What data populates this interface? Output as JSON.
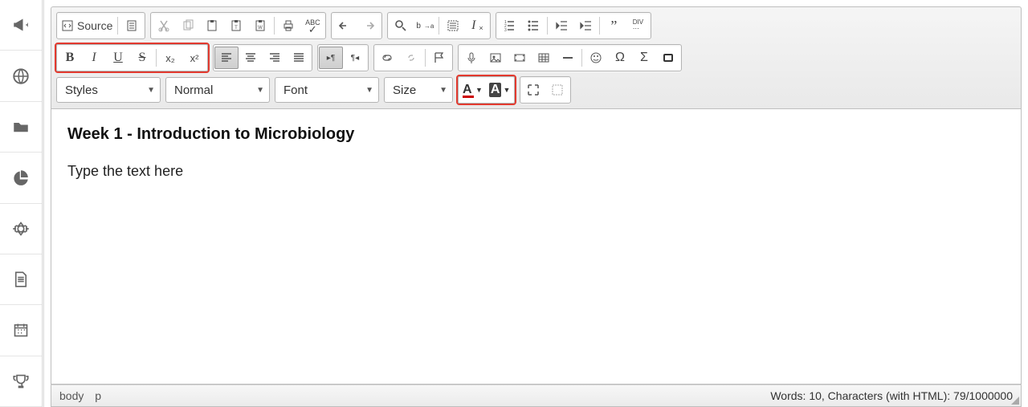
{
  "sidebar": {
    "items": [
      {
        "name": "bullhorn-icon"
      },
      {
        "name": "globe-icon"
      },
      {
        "name": "folder-icon"
      },
      {
        "name": "chart-pie-icon"
      },
      {
        "name": "gear-icon"
      },
      {
        "name": "file-icon"
      },
      {
        "name": "calendar-icon"
      },
      {
        "name": "trophy-icon"
      }
    ]
  },
  "toolbar": {
    "source_label": "Source",
    "styles_label": "Styles",
    "format_label": "Normal",
    "font_label": "Font",
    "size_label": "Size",
    "text_color_glyph": "A",
    "bg_color_glyph": "A",
    "format_buttons": {
      "bold": "B",
      "italic": "I",
      "underline": "U",
      "strike": "S",
      "sub": "x₂",
      "sup": "x²"
    },
    "spellcheck": "ᴬᴮᶜ",
    "div": "DIV"
  },
  "content": {
    "heading": "Week 1 - Introduction to Microbiology",
    "paragraph": "Type the text here"
  },
  "status": {
    "path_body": "body",
    "path_p": "p",
    "stats": "Words: 10, Characters (with HTML): 79/1000000"
  }
}
